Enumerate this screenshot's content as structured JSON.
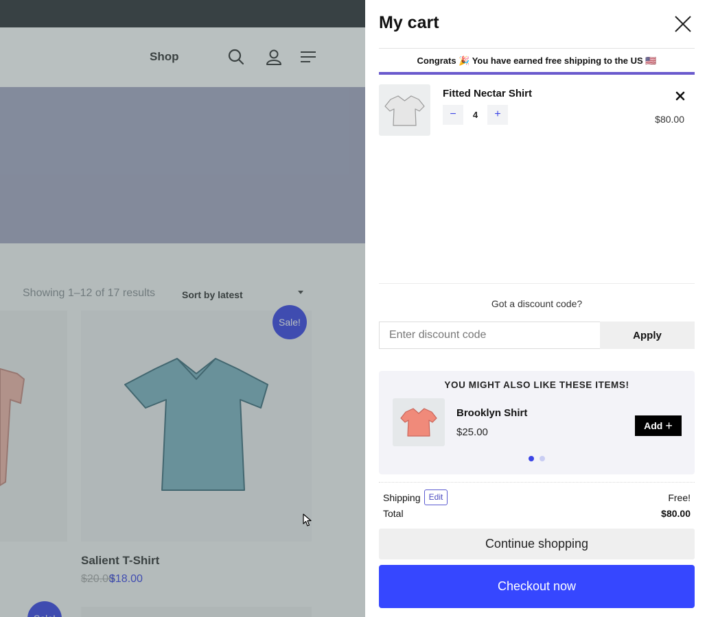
{
  "background_page": {
    "nav": {
      "shop_label": "Shop"
    },
    "results_text": "Showing 1–12 of 17 results",
    "sort_label": "Sort by latest",
    "sale_badge": "Sale!",
    "product": {
      "name": "Salient T-Shirt",
      "old_price": "$20.00",
      "price": "$18.00"
    }
  },
  "cart": {
    "title": "My cart",
    "shipping_message": "Congrats 🎉 You have earned free shipping to the US 🇺🇸",
    "items": [
      {
        "name": "Fitted Nectar Shirt",
        "quantity": "4",
        "price": "$80.00"
      }
    ],
    "discount": {
      "question": "Got a discount code?",
      "placeholder": "Enter discount code",
      "apply_label": "Apply"
    },
    "upsell": {
      "title": "YOU MIGHT ALSO LIKE THESE ITEMS!",
      "item": {
        "name": "Brooklyn Shirt",
        "price": "$25.00",
        "add_label": "Add"
      }
    },
    "totals": {
      "shipping_label": "Shipping",
      "edit_label": "Edit",
      "shipping_value": "Free!",
      "total_label": "Total",
      "total_value": "$80.00"
    },
    "continue_label": "Continue shopping",
    "checkout_label": "Checkout now"
  },
  "colors": {
    "accent": "#3647ff",
    "progress": "#6a5acd",
    "sale_badge": "#3b44e6",
    "upsell_shirt": "#f08a7a",
    "item_shirt": "#e6e6e6"
  },
  "icons": [
    "search-icon",
    "user-icon",
    "menu-icon",
    "close-icon",
    "remove-icon",
    "minus-icon",
    "plus-icon",
    "cursor-icon"
  ]
}
